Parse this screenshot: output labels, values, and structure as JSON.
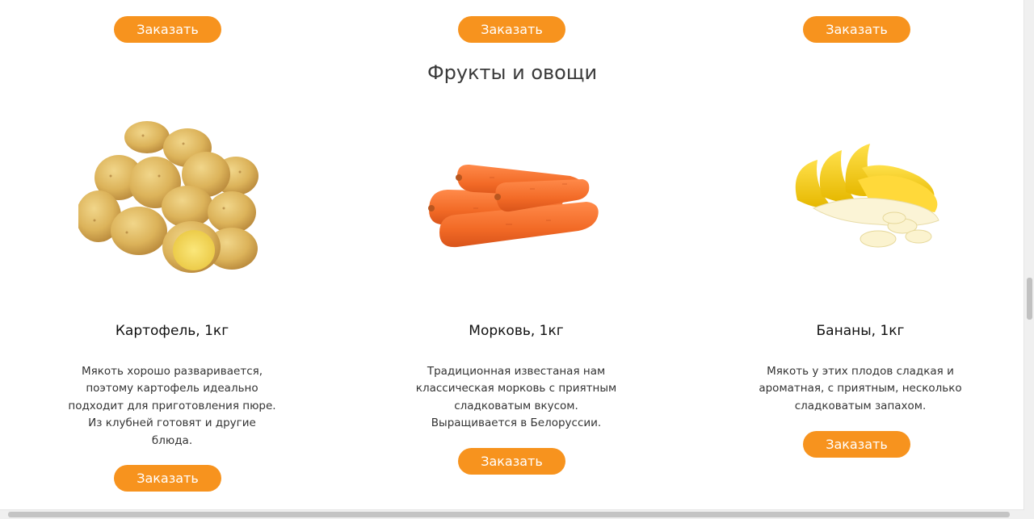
{
  "top_buttons": [
    {
      "label": "Заказать"
    },
    {
      "label": "Заказать"
    },
    {
      "label": "Заказать"
    }
  ],
  "section": {
    "title": "Фрукты и овощи"
  },
  "products": [
    {
      "name": "Картофель, 1кг",
      "image": "potato-image",
      "description": "Мякоть хорошо разваривается, поэтому картофель идеально подходит для приготовления пюре. Из клубней готовят и другие блюда.",
      "button": "Заказать"
    },
    {
      "name": "Морковь, 1кг",
      "image": "carrot-image",
      "description": "Традиционная известаная нам классическая морковь с приятным сладковатым вкусом. Выращивается в Белоруссии.",
      "button": "Заказать"
    },
    {
      "name": "Бананы, 1кг",
      "image": "banana-image",
      "description": "Мякоть у этих плодов сладкая и ароматная, с приятным, несколько сладковатым запахом.",
      "button": "Заказать"
    }
  ],
  "colors": {
    "accent": "#f7931e",
    "title": "#3a3a3a",
    "text": "#333333"
  }
}
